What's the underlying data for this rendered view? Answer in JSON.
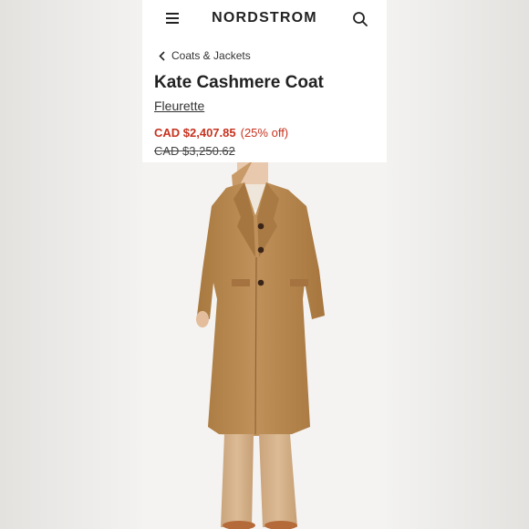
{
  "header": {
    "logo_text": "NORDSTROM",
    "menu_icon": "hamburger-menu-icon",
    "search_icon": "search-icon"
  },
  "breadcrumb": {
    "label": "Coats & Jackets",
    "icon": "chevron-left-icon"
  },
  "product": {
    "title": "Kate Cashmere Coat",
    "brand": "Fleurette",
    "sale_price": "CAD $2,407.85",
    "discount": "(25% off)",
    "original_price": "CAD $3,250.62",
    "image_description": "product-photo-camel-long-coat"
  },
  "colors": {
    "sale_red": "#c7331f",
    "coat_camel": "#b98a54",
    "background": "#ffffff"
  }
}
